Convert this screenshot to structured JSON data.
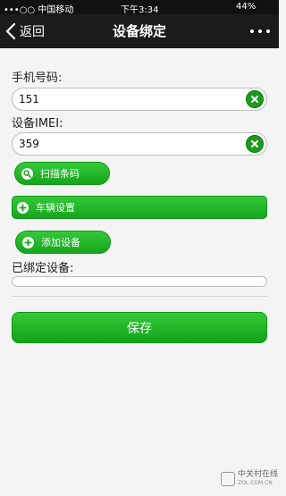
{
  "status_bar": {
    "carrier": "•••○○ 中国移动",
    "time": "下午3:34",
    "battery": "44%"
  },
  "nav": {
    "back_label": "返回",
    "title": "设备绑定"
  },
  "form": {
    "phone_label": "手机号码:",
    "phone_value": "151",
    "imei_label": "设备IMEI:",
    "imei_value": "359",
    "scan_button": "扫描条码",
    "vehicle_button": "车辆设置",
    "add_button": "添加设备",
    "bound_label": "已绑定设备:",
    "save_button": "保存"
  },
  "watermark": {
    "name": "中关村在线",
    "url": "ZOL.COM.CN"
  },
  "colors": {
    "accent_green": "#1aa81e",
    "nav_bg": "#1b1b1b",
    "page_bg": "#f4f4f4"
  }
}
